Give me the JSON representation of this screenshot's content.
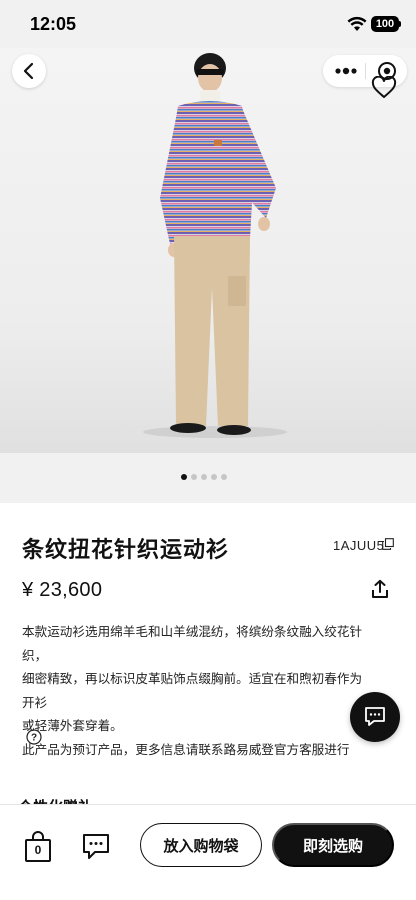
{
  "status_bar": {
    "time": "12:05",
    "battery": "100"
  },
  "nav": {
    "back_icon": "chevron-left-icon",
    "more_icon": "more-dots-icon",
    "target_icon": "target-icon",
    "favorite_icon": "heart-outline-icon"
  },
  "gallery": {
    "image_count": 5,
    "active_index": 0
  },
  "product": {
    "title": "条纹扭花针织运动衫",
    "sku": "1AJUU5",
    "price": "¥ 23,600",
    "description": [
      "本款运动衫选用绵羊毛和山羊绒混纺，将缤纷条纹融入绞花针织，",
      "细密精致，再以标识皮革贴饰点缀胸前。适宜在和煦初春作为开衫",
      "或轻薄外套穿着。",
      "此产品为预订产品，更多信息请联系路易威登官方客服进行"
    ]
  },
  "section": {
    "peek_title": "个性化赠礼"
  },
  "bottom_bar": {
    "bag_count": "0",
    "add_to_bag_label": "放入购物袋",
    "buy_now_label": "即刻选购"
  },
  "colors": {
    "primary": "#111111",
    "background": "#ffffff",
    "image_bg": "#f1f1f1"
  }
}
